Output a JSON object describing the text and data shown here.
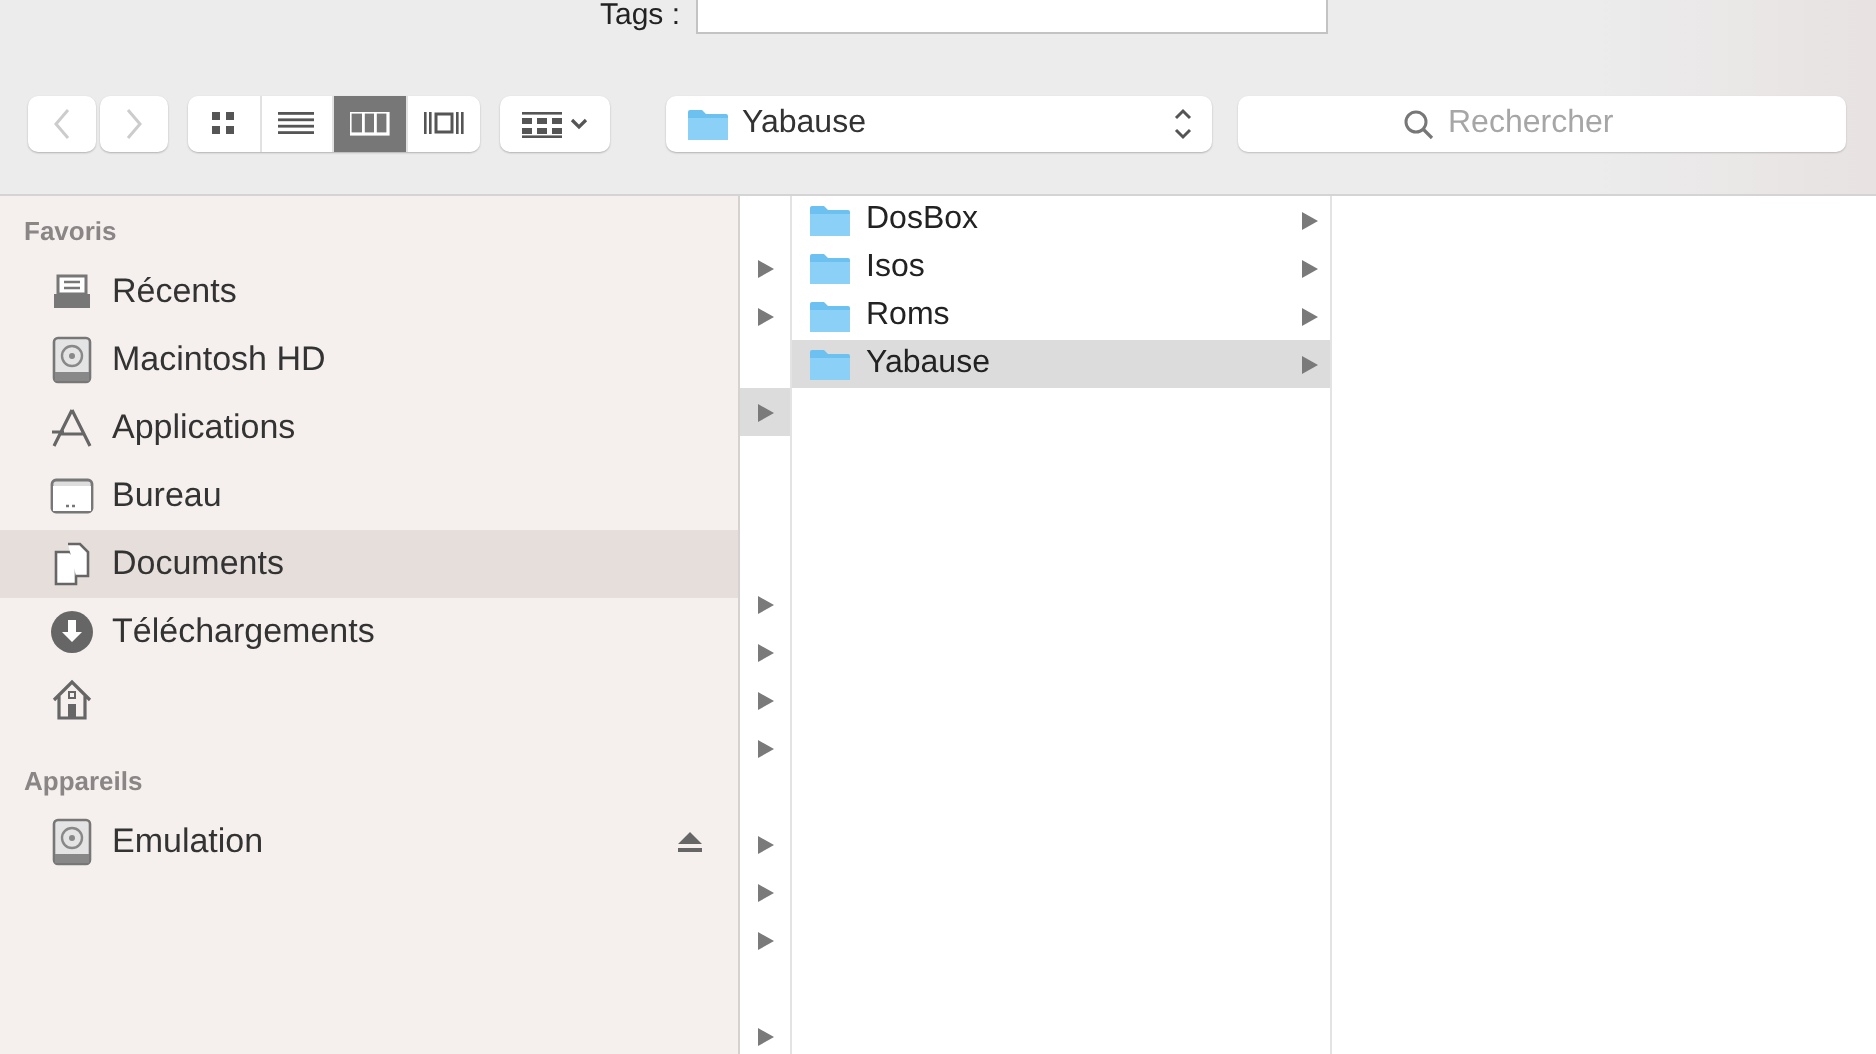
{
  "tags": {
    "label": "Tags :"
  },
  "toolbar": {
    "back": {
      "disabled": true
    },
    "forward": {
      "disabled": true
    },
    "views": [
      {
        "kind": "icon",
        "selected": false
      },
      {
        "kind": "list",
        "selected": false
      },
      {
        "kind": "column",
        "selected": true
      },
      {
        "kind": "coverflow",
        "selected": false
      }
    ],
    "path": {
      "label": "Yabause"
    },
    "search": {
      "placeholder": "Rechercher"
    }
  },
  "sidebar": {
    "sections": [
      {
        "title": "Favoris",
        "items": [
          {
            "kind": "recents",
            "label": "Récents",
            "selected": false
          },
          {
            "kind": "disk",
            "label": "Macintosh HD",
            "selected": false
          },
          {
            "kind": "apps",
            "label": "Applications",
            "selected": false
          },
          {
            "kind": "desktop",
            "label": "Bureau",
            "selected": false
          },
          {
            "kind": "documents",
            "label": "Documents",
            "selected": true
          },
          {
            "kind": "downloads",
            "label": "Téléchargements",
            "selected": false
          },
          {
            "kind": "home",
            "selected": false
          }
        ]
      },
      {
        "title": "Appareils",
        "items": [
          {
            "kind": "disk",
            "label": "Emulation",
            "selected": false,
            "ejectable": true
          }
        ]
      }
    ]
  },
  "browser": {
    "column_1": {
      "rows": [
        {
          "kind": "gap"
        },
        {
          "kind": "arrow",
          "selected": false
        },
        {
          "kind": "arrow",
          "selected": false
        },
        {
          "kind": "gap"
        },
        {
          "kind": "arrow",
          "selected": true
        },
        {
          "kind": "gap"
        },
        {
          "kind": "gap"
        },
        {
          "kind": "gap"
        },
        {
          "kind": "arrow",
          "selected": false
        },
        {
          "kind": "arrow",
          "selected": false
        },
        {
          "kind": "arrow",
          "selected": false
        },
        {
          "kind": "arrow",
          "selected": false
        },
        {
          "kind": "gap"
        },
        {
          "kind": "arrow",
          "selected": false
        },
        {
          "kind": "arrow",
          "selected": false
        },
        {
          "kind": "arrow",
          "selected": false
        },
        {
          "kind": "gap"
        },
        {
          "kind": "arrow",
          "selected": false
        }
      ]
    },
    "column_2": {
      "rows": [
        {
          "label": "DosBox",
          "expandable": true,
          "selected": false
        },
        {
          "label": "Isos",
          "expandable": true,
          "selected": false
        },
        {
          "label": "Roms",
          "expandable": true,
          "selected": false
        },
        {
          "label": "Yabause",
          "expandable": true,
          "selected": true
        }
      ]
    }
  }
}
